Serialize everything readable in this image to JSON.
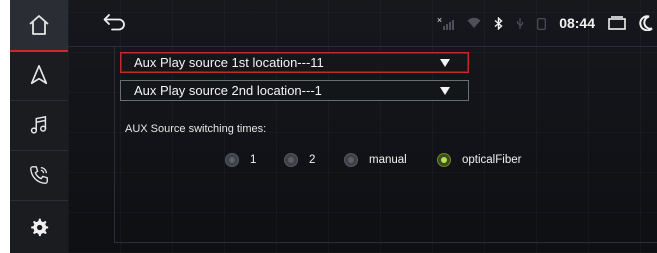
{
  "status_bar": {
    "clock": "08:44",
    "signal_badge": "×"
  },
  "settings": {
    "dropdowns": [
      {
        "label": "Aux Play source 1st location---11",
        "selected": true
      },
      {
        "label": "Aux Play source 2nd location---1",
        "selected": false
      }
    ],
    "switching_label": "AUX Source switching times:",
    "radio_options": [
      {
        "label": "1",
        "checked": false
      },
      {
        "label": "2",
        "checked": false
      },
      {
        "label": "manual",
        "checked": false
      },
      {
        "label": "opticalFiber",
        "checked": true
      }
    ]
  },
  "colors": {
    "accent_red": "#cc2a2a",
    "radio_checked": "#b4e34a",
    "background": "#111318",
    "sidebar": "#1a1c20"
  },
  "icons": {
    "sidebar": [
      "home-icon",
      "navigation-icon",
      "music-icon",
      "phone-icon",
      "settings-gear-icon"
    ],
    "status": [
      "signal-icon",
      "wifi-icon",
      "bluetooth-icon",
      "usb-icon",
      "battery-icon",
      "recent-apps-icon",
      "night-mode-icon"
    ]
  }
}
